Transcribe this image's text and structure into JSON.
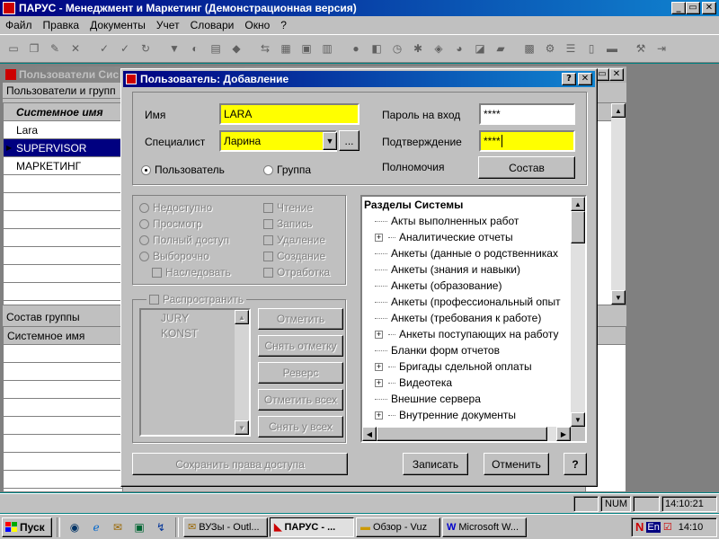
{
  "app": {
    "title": "ПАРУС - Менеджмент и Маркетинг (Демонстрационная версия)"
  },
  "menu": [
    "Файл",
    "Правка",
    "Документы",
    "Учет",
    "Словари",
    "Окно",
    "?"
  ],
  "bg_window": {
    "title": "Пользователи Сис",
    "subtitle": "Пользователи и групп",
    "col_header": "Системное имя",
    "rows": [
      "Lara",
      "SUPERVISOR",
      "МАРКЕТИНГ"
    ],
    "selected_index": 1,
    "group_title": "Состав группы",
    "group_col": "Системное имя"
  },
  "dialog": {
    "title": "Пользователь: Добавление",
    "name_label": "Имя",
    "name_value": "LARA",
    "specialist_label": "Специалист",
    "specialist_value": "Ларина",
    "specialist_dots": "...",
    "password_label": "Пароль на вход",
    "password_value": "****",
    "confirm_label": "Подтверждение",
    "confirm_value": "****",
    "permissions_label": "Полномочия",
    "composition_button": "Состав",
    "radio_user": "Пользователь",
    "radio_group": "Группа",
    "access": [
      "Недоступно",
      "Просмотр",
      "Полный доступ",
      "Выборочно"
    ],
    "rights": [
      "Чтение",
      "Запись",
      "Удаление",
      "Создание",
      "Отработка"
    ],
    "inherit": "Наследовать",
    "spread": "Распространить",
    "users_list": [
      "JURY",
      "KONST"
    ],
    "action_buttons": [
      "Отметить",
      "Снять отметку",
      "Реверс",
      "Отметить всех",
      "Снять у всех"
    ],
    "save_rights": "Сохранить права доступа",
    "tree_title": "Разделы Системы",
    "tree": [
      {
        "label": "Акты выполненных работ",
        "expandable": false
      },
      {
        "label": "Аналитические отчеты",
        "expandable": true
      },
      {
        "label": "Анкеты (данные о родственниках",
        "expandable": false
      },
      {
        "label": "Анкеты (знания и навыки)",
        "expandable": false
      },
      {
        "label": "Анкеты (образование)",
        "expandable": false
      },
      {
        "label": "Анкеты (профессиональный опыт",
        "expandable": false
      },
      {
        "label": "Анкеты (требования к работе)",
        "expandable": false
      },
      {
        "label": "Анкеты поступающих на работу",
        "expandable": true
      },
      {
        "label": "Бланки форм отчетов",
        "expandable": false
      },
      {
        "label": "Бригады сдельной оплаты",
        "expandable": true
      },
      {
        "label": "Видеотека",
        "expandable": true
      },
      {
        "label": "Внешние сервера",
        "expandable": false
      },
      {
        "label": "Внутренние документы",
        "expandable": true
      }
    ],
    "write": "Записать",
    "cancel": "Отменить",
    "help": "?"
  },
  "statusbar": {
    "num": "NUM",
    "time": "14:10:21"
  },
  "taskbar": {
    "start": "Пуск",
    "tasks": [
      "ВУЗы - Outl...",
      "ПАРУС - ...",
      "Обзор - Vuz",
      "Microsoft W..."
    ],
    "active_index": 1,
    "lang": "En",
    "clock": "14:10"
  }
}
